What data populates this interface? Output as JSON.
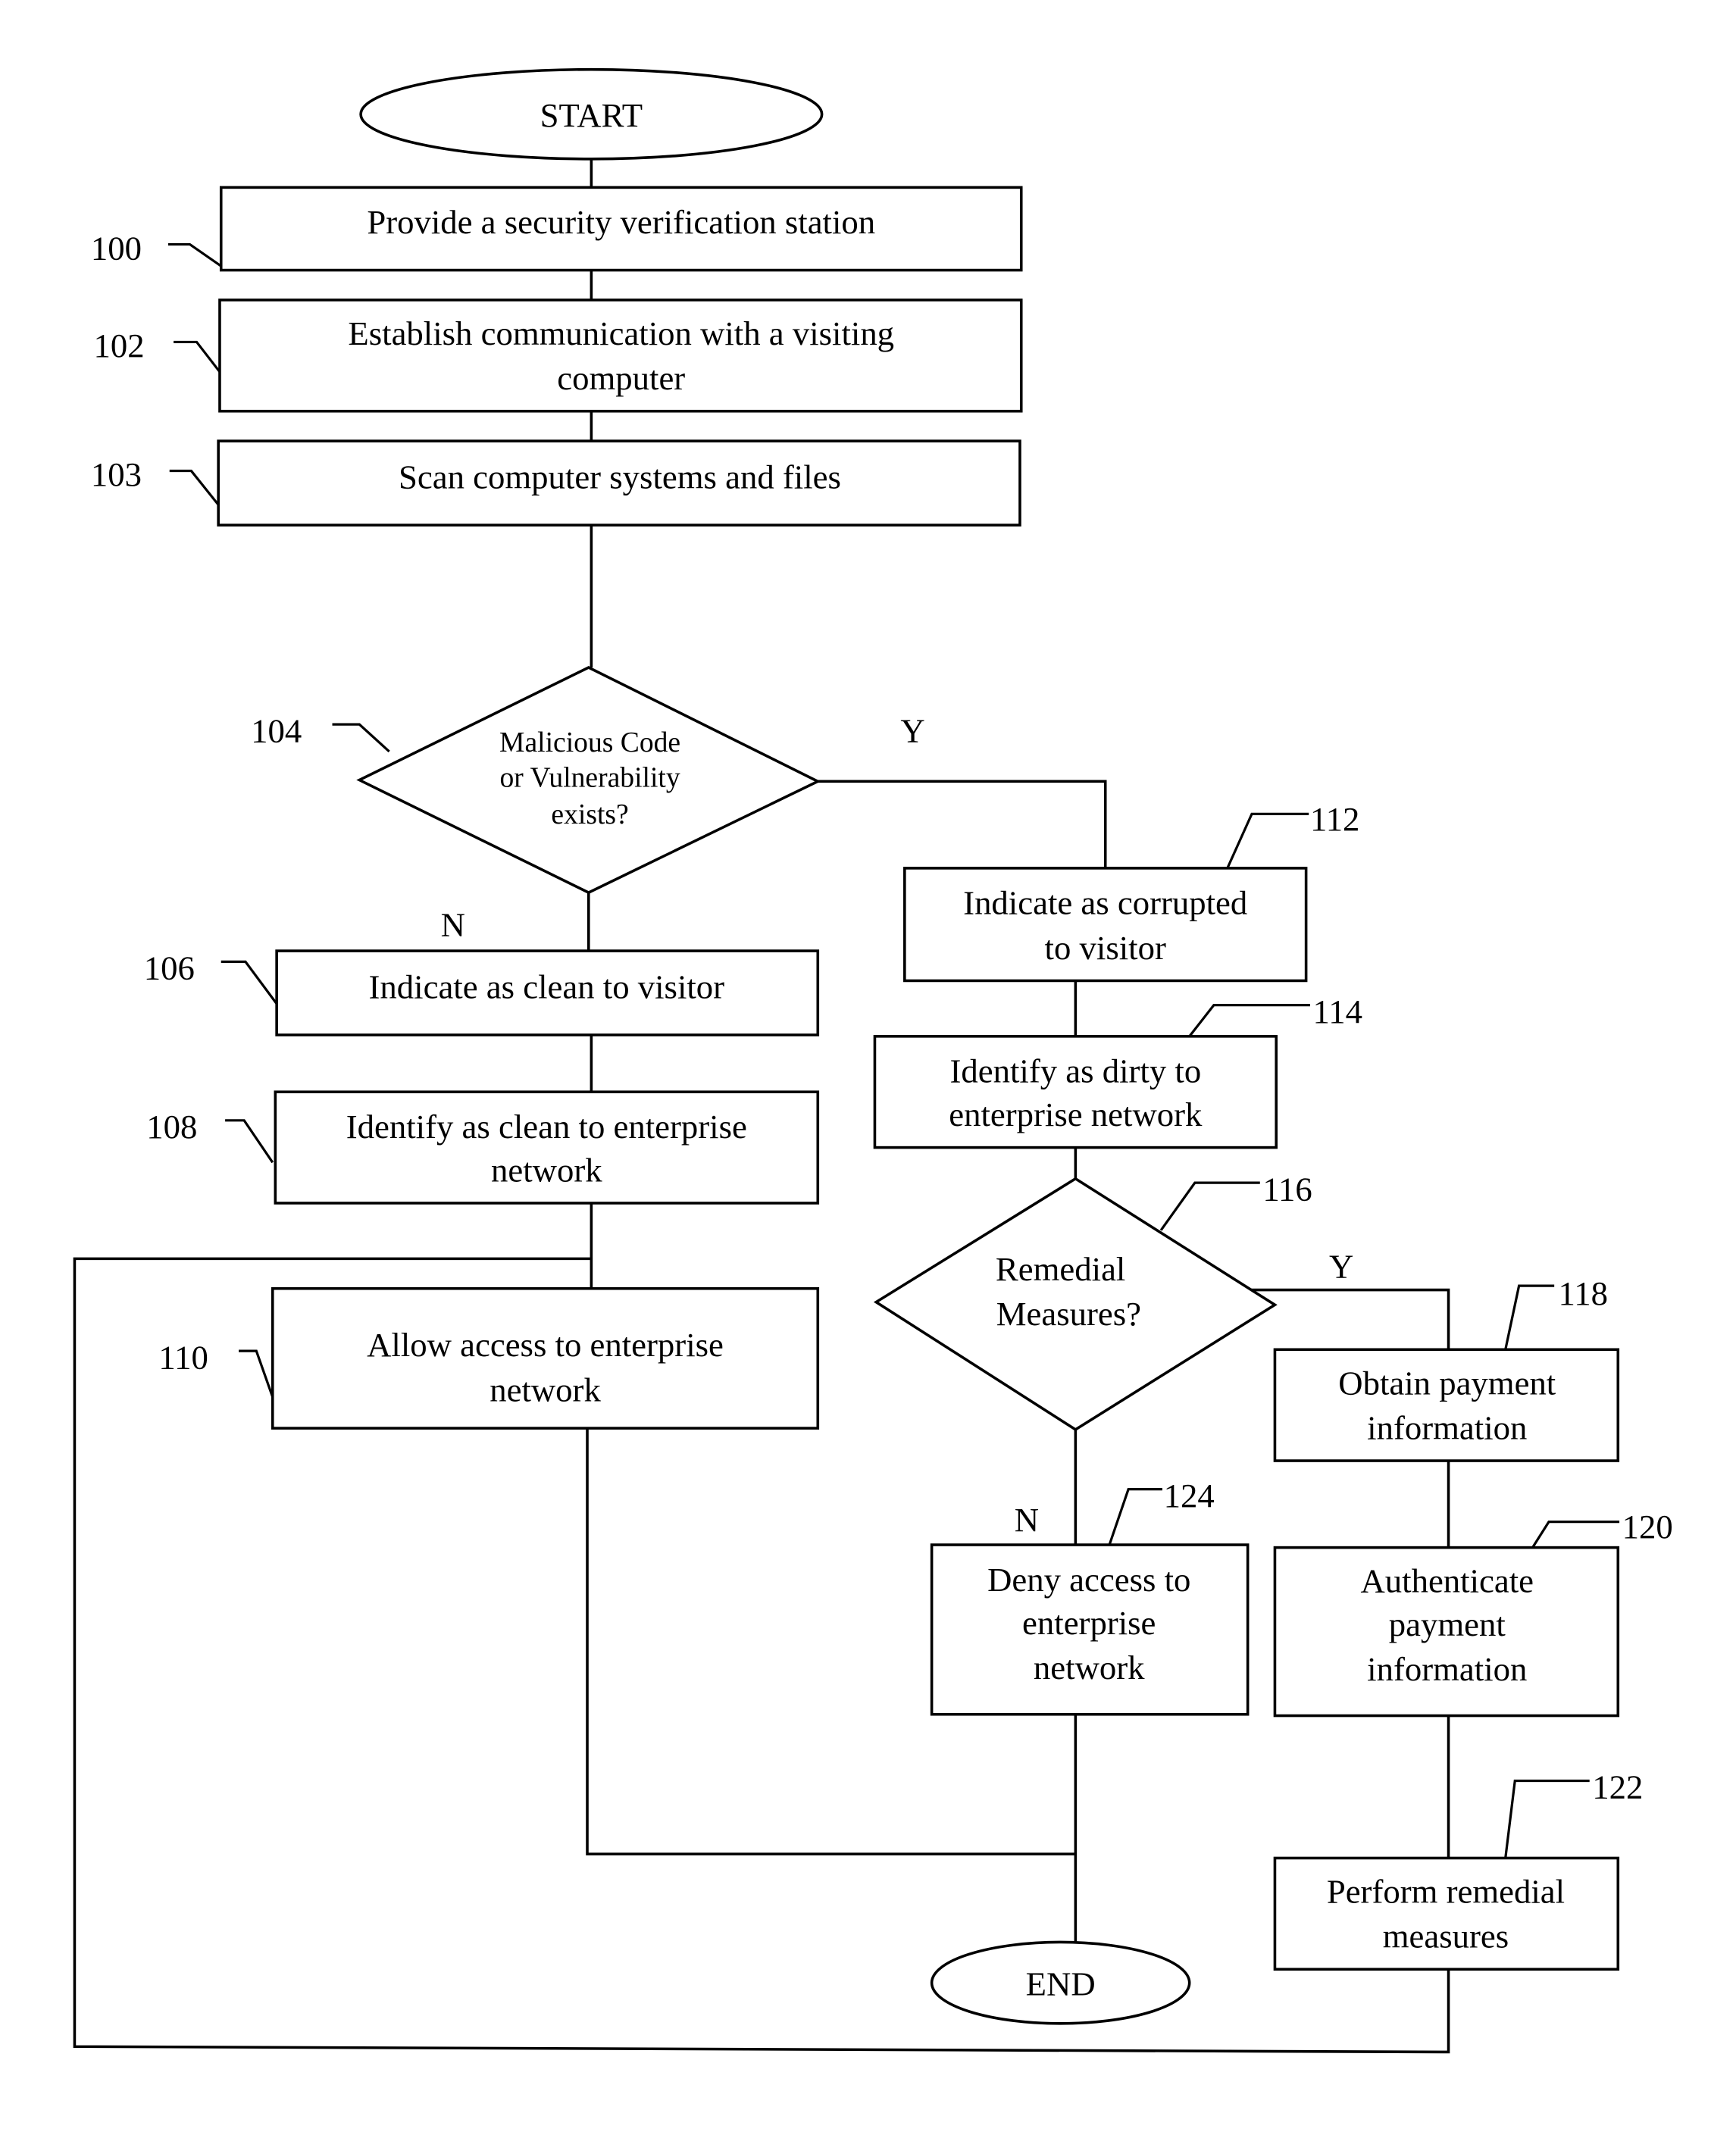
{
  "diagram": {
    "type": "flowchart",
    "terminals": {
      "start": "START",
      "end": "END"
    },
    "steps": [
      {
        "id": "100",
        "ref": "100",
        "lines": [
          "Provide a security verification station"
        ]
      },
      {
        "id": "102",
        "ref": "102",
        "lines": [
          "Establish communication with a visiting",
          "computer"
        ]
      },
      {
        "id": "103",
        "ref": "103",
        "lines": [
          "Scan computer systems and files"
        ]
      },
      {
        "id": "106",
        "ref": "106",
        "lines": [
          "Indicate as clean to visitor"
        ]
      },
      {
        "id": "108",
        "ref": "108",
        "lines": [
          "Identify as clean to enterprise",
          "network"
        ]
      },
      {
        "id": "110",
        "ref": "110",
        "lines": [
          "Allow access to enterprise",
          "network"
        ]
      },
      {
        "id": "112",
        "ref": "112",
        "lines": [
          "Indicate as corrupted",
          "to visitor"
        ]
      },
      {
        "id": "114",
        "ref": "114",
        "lines": [
          "Identify as dirty to",
          "enterprise network"
        ]
      },
      {
        "id": "118",
        "ref": "118",
        "lines": [
          "Obtain payment",
          "information"
        ]
      },
      {
        "id": "120",
        "ref": "120",
        "lines": [
          "Authenticate",
          "payment",
          "information"
        ]
      },
      {
        "id": "122",
        "ref": "122",
        "lines": [
          "Perform remedial",
          "measures"
        ]
      },
      {
        "id": "124",
        "ref": "124",
        "lines": [
          "Deny access to",
          "enterprise",
          "network"
        ]
      }
    ],
    "decisions": [
      {
        "id": "104",
        "ref": "104",
        "lines": [
          "Malicious Code",
          "or Vulnerability",
          "exists?"
        ],
        "yes_label": "Y",
        "no_label": "N"
      },
      {
        "id": "116",
        "ref": "116",
        "lines": [
          "Remedial",
          "Measures?"
        ],
        "yes_label": "Y",
        "no_label": "N"
      }
    ]
  }
}
